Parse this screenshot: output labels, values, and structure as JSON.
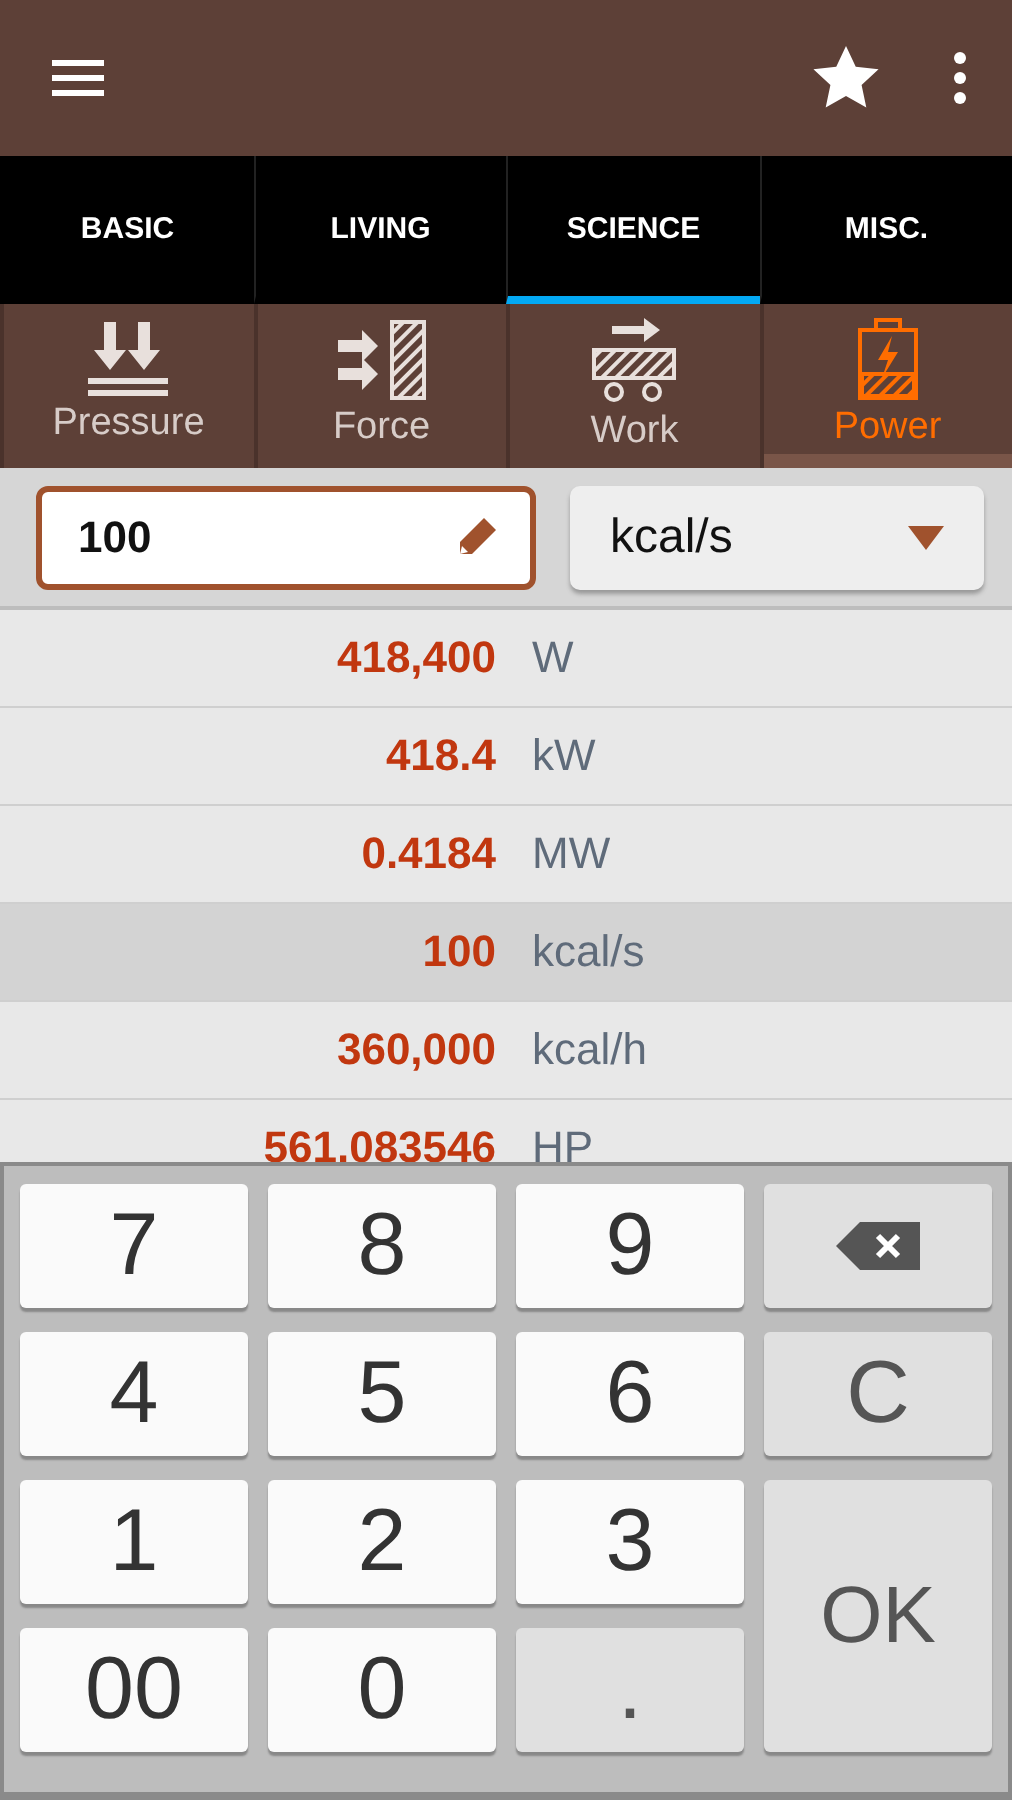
{
  "tabs": [
    {
      "label": "BASIC",
      "selected": false
    },
    {
      "label": "LIVING",
      "selected": false
    },
    {
      "label": "SCIENCE",
      "selected": true
    },
    {
      "label": "MISC.",
      "selected": false
    }
  ],
  "categories": [
    {
      "label": "Pressure",
      "kind": "pressure",
      "selected": false
    },
    {
      "label": "Force",
      "kind": "force",
      "selected": false
    },
    {
      "label": "Work",
      "kind": "work",
      "selected": false
    },
    {
      "label": "Power",
      "kind": "power",
      "selected": true
    }
  ],
  "input": {
    "value": "100"
  },
  "unit_select": {
    "value": "kcal/s"
  },
  "results": [
    {
      "value": "418,400",
      "unit": "W",
      "selected": false
    },
    {
      "value": "418.4",
      "unit": "kW",
      "selected": false
    },
    {
      "value": "0.4184",
      "unit": "MW",
      "selected": false
    },
    {
      "value": "100",
      "unit": "kcal/s",
      "selected": true
    },
    {
      "value": "360,000",
      "unit": "kcal/h",
      "selected": false
    },
    {
      "value": "561.083546",
      "unit": "HP",
      "selected": false
    }
  ],
  "keypad": [
    {
      "kind": "digit",
      "label": "7"
    },
    {
      "kind": "digit",
      "label": "8"
    },
    {
      "kind": "digit",
      "label": "9"
    },
    {
      "kind": "backspace"
    },
    {
      "kind": "digit",
      "label": "4"
    },
    {
      "kind": "digit",
      "label": "5"
    },
    {
      "kind": "digit",
      "label": "6"
    },
    {
      "kind": "clear",
      "label": "C"
    },
    {
      "kind": "digit",
      "label": "1"
    },
    {
      "kind": "digit",
      "label": "2"
    },
    {
      "kind": "digit",
      "label": "3"
    },
    {
      "kind": "ok",
      "label": "OK"
    },
    {
      "kind": "digit",
      "label": "00"
    },
    {
      "kind": "digit",
      "label": "0"
    },
    {
      "kind": "dot",
      "label": "."
    }
  ]
}
